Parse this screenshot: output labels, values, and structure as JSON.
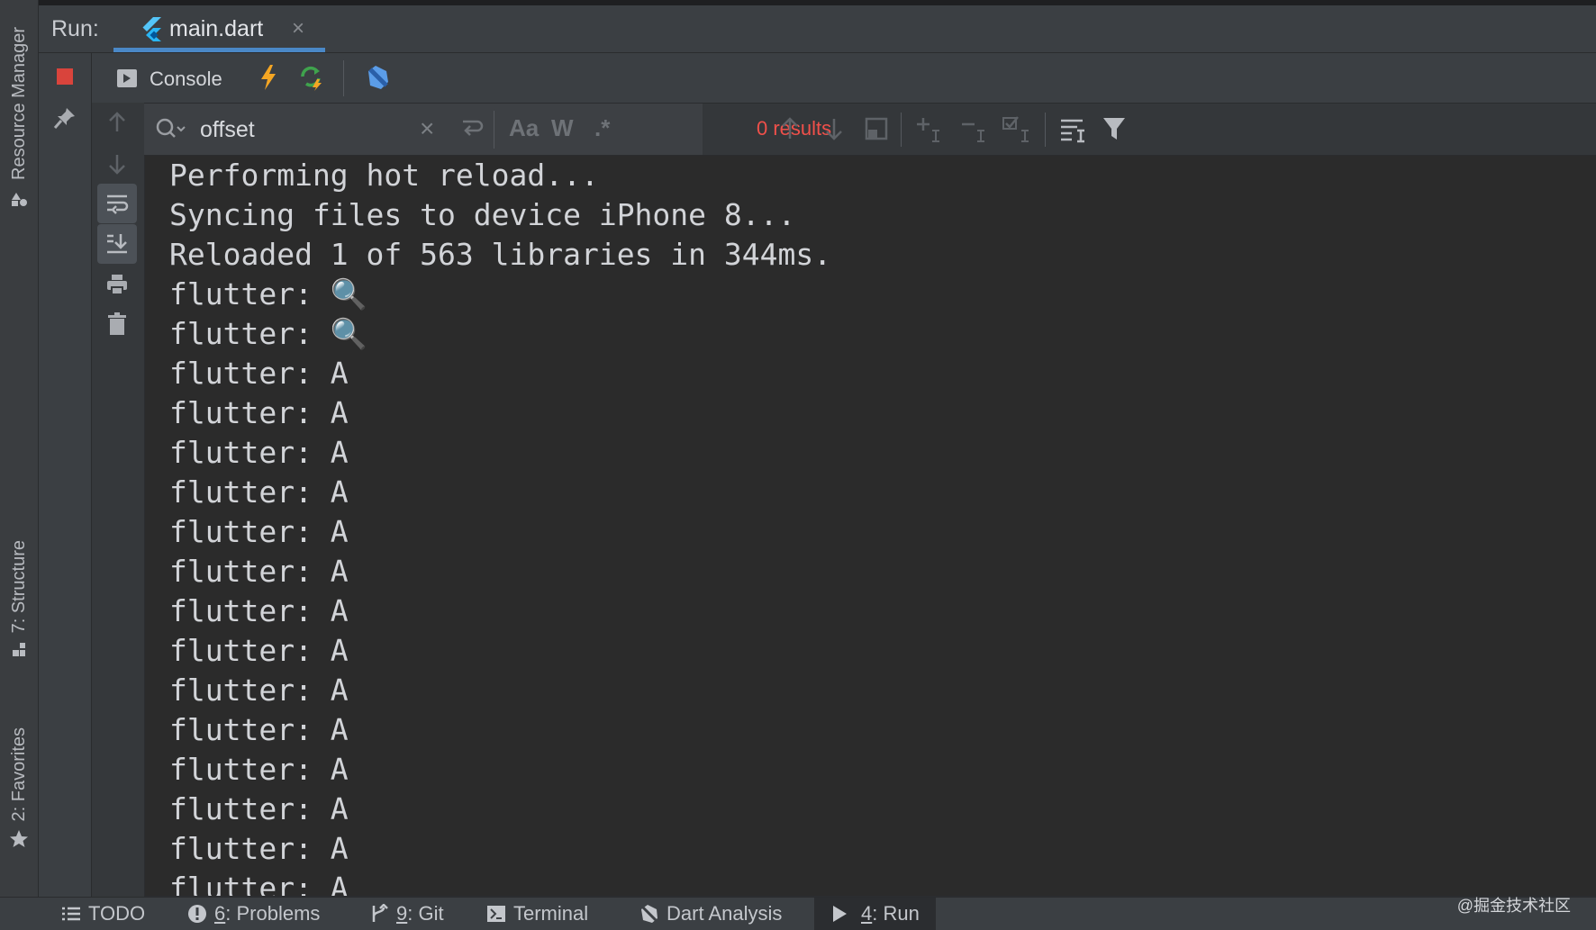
{
  "left_stripe": {
    "resource_manager": "Resource Manager",
    "structure": "7: Structure",
    "favorites": "2: Favorites"
  },
  "run_header": {
    "label": "Run:",
    "tab_title": "main.dart",
    "tab_close": "×"
  },
  "console_toolbar": {
    "console_label": "Console"
  },
  "search": {
    "query": "offset",
    "clear": "×",
    "match_case": "Aa",
    "words": "W",
    "regex": ".*",
    "results": "0 results"
  },
  "console": {
    "lines": [
      "Performing hot reload...",
      "Syncing files to device iPhone 8...",
      "Reloaded 1 of 563 libraries in 344ms.",
      "flutter: 🔍",
      "flutter: 🔍",
      "flutter: A",
      "flutter: A",
      "flutter: A",
      "flutter: A",
      "flutter: A",
      "flutter: A",
      "flutter: A",
      "flutter: A",
      "flutter: A",
      "flutter: A",
      "flutter: A",
      "flutter: A",
      "flutter: A",
      "flutter: A"
    ]
  },
  "bottom_bar": {
    "todo": "TODO",
    "problems_num": "6",
    "problems_label": ": Problems",
    "git_num": "9",
    "git_label": ": Git",
    "terminal": "Terminal",
    "dart_analysis": "Dart Analysis",
    "run_num": "4",
    "run_label": ": Run"
  },
  "watermark": "@掘金技术社区",
  "colors": {
    "accent": "#4a88c7",
    "results_red": "#f0504a",
    "stop_red": "#d9443c",
    "hot_reload": "#f5a623",
    "hot_restart": "#3fa34d"
  }
}
